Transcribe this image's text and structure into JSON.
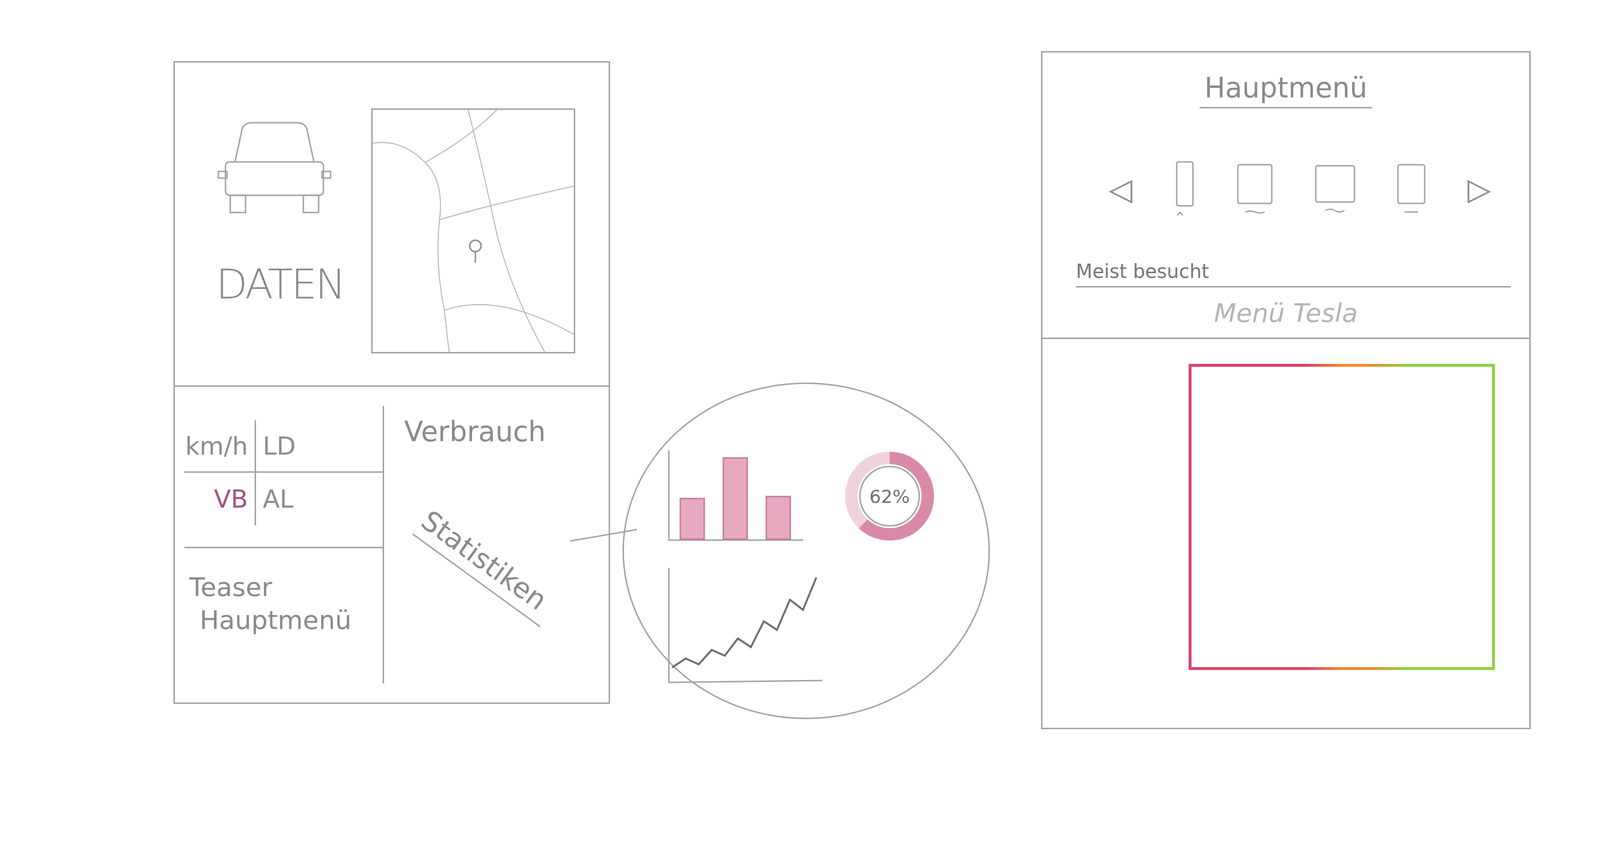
{
  "data_panel": {
    "title": "DATEN"
  },
  "quick_stats": [
    {
      "label": "km/h",
      "color": "#8c8c8c"
    },
    {
      "label": "LD",
      "color": "#8c8c8c"
    },
    {
      "label": "VB",
      "color": "#a0557f"
    },
    {
      "label": "AL",
      "color": "#8c8c8c"
    }
  ],
  "teaser": {
    "lines": [
      "Teaser",
      "Hauptmenü"
    ]
  },
  "consumption": {
    "title": "Verbrauch",
    "subtitle": "Statistiken"
  },
  "stats_detail": {
    "bars": [
      40,
      80,
      42
    ],
    "donut": {
      "label": "62%",
      "level": 0.62
    },
    "line": [
      8,
      14,
      10,
      20,
      16,
      28,
      22,
      40,
      34,
      55,
      48,
      70
    ]
  },
  "main_menu": {
    "title": "Hauptmenü",
    "prev": "◁",
    "next": "▷",
    "devices": [
      {
        "kind": "phone"
      },
      {
        "kind": "tablet"
      },
      {
        "kind": "monitor"
      },
      {
        "kind": "handheld"
      }
    ],
    "section": "Meist besucht",
    "current": "Menü Tesla"
  }
}
